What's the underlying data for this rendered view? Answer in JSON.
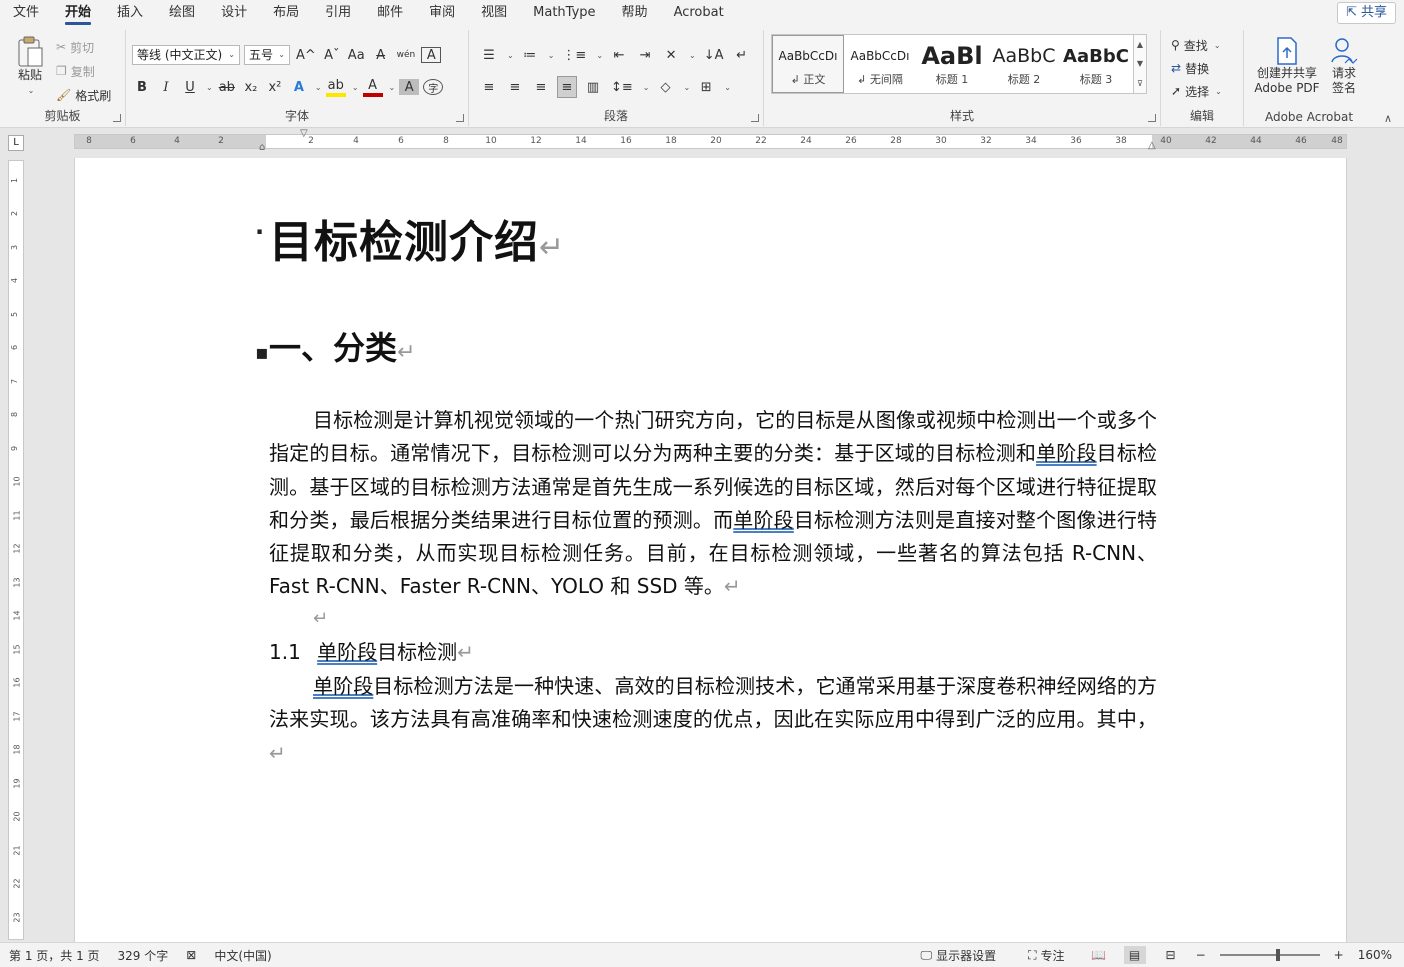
{
  "menu": {
    "tabs": [
      "文件",
      "开始",
      "插入",
      "绘图",
      "设计",
      "布局",
      "引用",
      "邮件",
      "审阅",
      "视图",
      "MathType",
      "帮助",
      "Acrobat"
    ],
    "active": "开始",
    "share": "共享"
  },
  "clipboard": {
    "paste": "粘贴",
    "cut": "剪切",
    "copy": "复制",
    "format_painter": "格式刷",
    "label": "剪贴板"
  },
  "font": {
    "name": "等线 (中文正文)",
    "size": "五号",
    "label": "字体",
    "bold": "B",
    "italic": "I",
    "underline": "U",
    "strike": "ab",
    "subscript": "x₂",
    "superscript": "x²",
    "grow": "A^",
    "shrink": "Aˇ",
    "change_case": "Aa",
    "clear_format": "A",
    "phonetic": "wén",
    "char_border": "A",
    "text_effect": "A",
    "highlight": "ab",
    "font_color": "A",
    "char_shading": "A",
    "enclose": "字"
  },
  "paragraph": {
    "label": "段落"
  },
  "styles": {
    "label": "样式",
    "items": [
      {
        "preview": "AaBbCcDı",
        "name": "↲ 正文"
      },
      {
        "preview": "AaBbCcDı",
        "name": "↲ 无间隔"
      },
      {
        "preview": "AaBl",
        "name": "标题 1"
      },
      {
        "preview": "AaBbC",
        "name": "标题 2"
      },
      {
        "preview": "AaBbC",
        "name": "标题 3"
      }
    ]
  },
  "editing": {
    "label": "编辑",
    "find": "查找",
    "replace": "替换",
    "select": "选择"
  },
  "acrobat": {
    "label": "Adobe Acrobat",
    "create_line1": "创建并共享",
    "create_line2": "Adobe PDF",
    "sign_line1": "请求",
    "sign_line2": "签名"
  },
  "ruler": {
    "corner": "L",
    "left_ticks": [
      "8",
      "6",
      "4",
      "2"
    ],
    "right_ticks": [
      "2",
      "4",
      "6",
      "8",
      "10",
      "12",
      "14",
      "16",
      "18",
      "20",
      "22",
      "24",
      "26",
      "28",
      "30",
      "32",
      "34",
      "36",
      "38",
      "40",
      "42",
      "44",
      "46",
      "48"
    ],
    "vertical_ticks": [
      "1",
      "2",
      "3",
      "4",
      "5",
      "6",
      "7",
      "8",
      "9",
      "10",
      "11",
      "12",
      "13",
      "14",
      "15",
      "16",
      "17",
      "18",
      "19",
      "20",
      "21",
      "22",
      "23"
    ]
  },
  "document": {
    "title": "目标检测介绍",
    "section": "一、分类",
    "para_mark": "↵",
    "p1_parts": [
      "目标检测是计算机视觉领域的一个热门研究方向，它的目标是从图像或视频中检测出一个或多个指定的目标。通常情况下，目标检测可以分为两种主要的分类：基于区域的目标检测和",
      "单阶段",
      "目标检测。基于区域的目标检测方法通常是首先生成一系列候选的目标区域，然后对每个区域进行特征提取和分类，最后根据分类结果进行目标位置的预测。而",
      "单阶段",
      "目标检测方法则是直接对整个图像进行特征提取和分类，从而实现目标检测任务。目前，在目标检测领域，一些著名的算法包括 R-CNN、Fast R-CNN、Faster R-CNN、YOLO 和 SSD 等。"
    ],
    "subsection_num": "1.1",
    "subsection_parts": [
      "单阶段",
      "目标检测"
    ],
    "p3_parts": [
      "单阶段",
      "目标检测方法是一种快速、高效的目标检测技术，它通常采用基于深度卷积神经网络的方法来实现。该方法具有高准确率和快速检测速度的优点，因此在实际应用中得到广泛的应用。其中，"
    ]
  },
  "status": {
    "page": "第 1 页，共 1 页",
    "words": "329 个字",
    "language": "中文(中国)",
    "display_settings": "显示器设置",
    "focus": "专注",
    "zoom_minus": "−",
    "zoom_plus": "+",
    "zoom": "160%"
  }
}
